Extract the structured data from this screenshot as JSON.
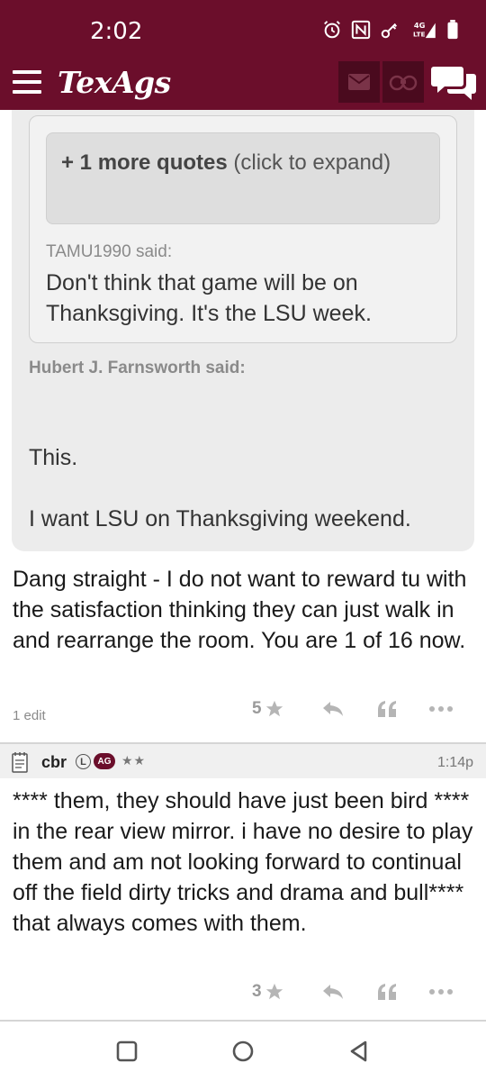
{
  "status_bar": {
    "time": "2:02",
    "network": "4G LTE",
    "icons": [
      "alarm-icon",
      "nfc-icon",
      "key-icon",
      "signal-icon",
      "battery-icon"
    ]
  },
  "header": {
    "logo": "TexAgs",
    "icons": [
      "menu-icon",
      "mail-icon",
      "binoculars-icon",
      "chat-icon"
    ],
    "colors": {
      "brand": "#6b0e2b"
    }
  },
  "quote_block": {
    "more_quotes_bold": "+ 1 more quotes",
    "more_quotes_rest": " (click to expand)",
    "inner_author": "TAMU1990 said:",
    "inner_text": "Don't think that game will be on Thanksgiving. It's the LSU week.",
    "outer_author": "Hubert J. Farnsworth said:",
    "outer_text_1": "This.",
    "outer_text_2": "I want LSU on Thanksgiving weekend."
  },
  "post1": {
    "body": "Dang straight - I do not want to reward tu with the satisfaction thinking they can just walk in and rearrange the room. You are 1 of 16 now.",
    "edit_note": "1 edit",
    "likes": "5"
  },
  "post2": {
    "username": "cbr",
    "badge_l": "L",
    "badge_ag": "AG",
    "stars": "★★",
    "time": "1:14p",
    "body": "**** them, they should have just been bird **** in the rear view mirror. i have no desire to play them and am not looking forward to continual off the field dirty tricks and drama and bull**** that always comes with them.",
    "likes": "3"
  },
  "nav_bar": {
    "buttons": [
      "recents-icon",
      "home-icon",
      "back-icon"
    ]
  }
}
